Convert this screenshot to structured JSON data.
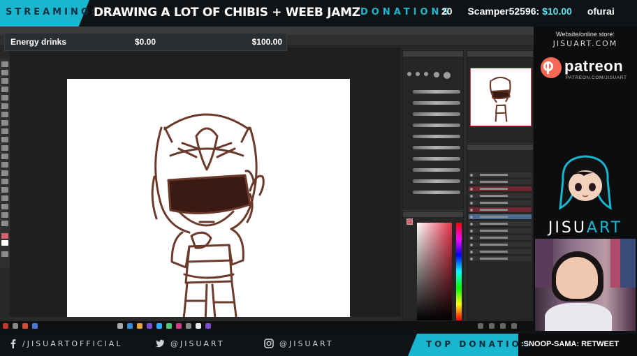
{
  "header": {
    "streaming_label": "STREAMING:",
    "stream_title": "DRAWING A LOT OF CHIBIS + WEEB JAMZ",
    "donations_label": "DONATIONS",
    "ticker": [
      {
        "name": "20",
        "amount": ""
      },
      {
        "name": "Scamper52596:",
        "amount": "$10.00"
      },
      {
        "name": "ofurai",
        "amount": ""
      }
    ]
  },
  "goal": {
    "label": "Energy drinks",
    "current": "$0.00",
    "target": "$100.00",
    "progress_fraction": 0
  },
  "sidebar": {
    "site_label": "Website/online store:",
    "site_url": "JISUART.COM",
    "patreon_word": "patreon",
    "patreon_url": "PATREON.COM/JISUART",
    "brand_main": "JISU",
    "brand_accent": "ART"
  },
  "footer": {
    "facebook": "/JISUARTOFFICIAL",
    "twitter": "@JISUART",
    "instagram": "@JISUART",
    "top_donation_label": "TOP DONATION",
    "top_donation_value": ":SNOOP-SAMA: RETWEET"
  },
  "colors": {
    "accent": "#18b6cf",
    "sketch": "#6b3a2a",
    "patreon": "#f96854"
  },
  "icons": [
    "facebook-icon",
    "twitter-icon",
    "instagram-icon",
    "patreon-icon"
  ]
}
